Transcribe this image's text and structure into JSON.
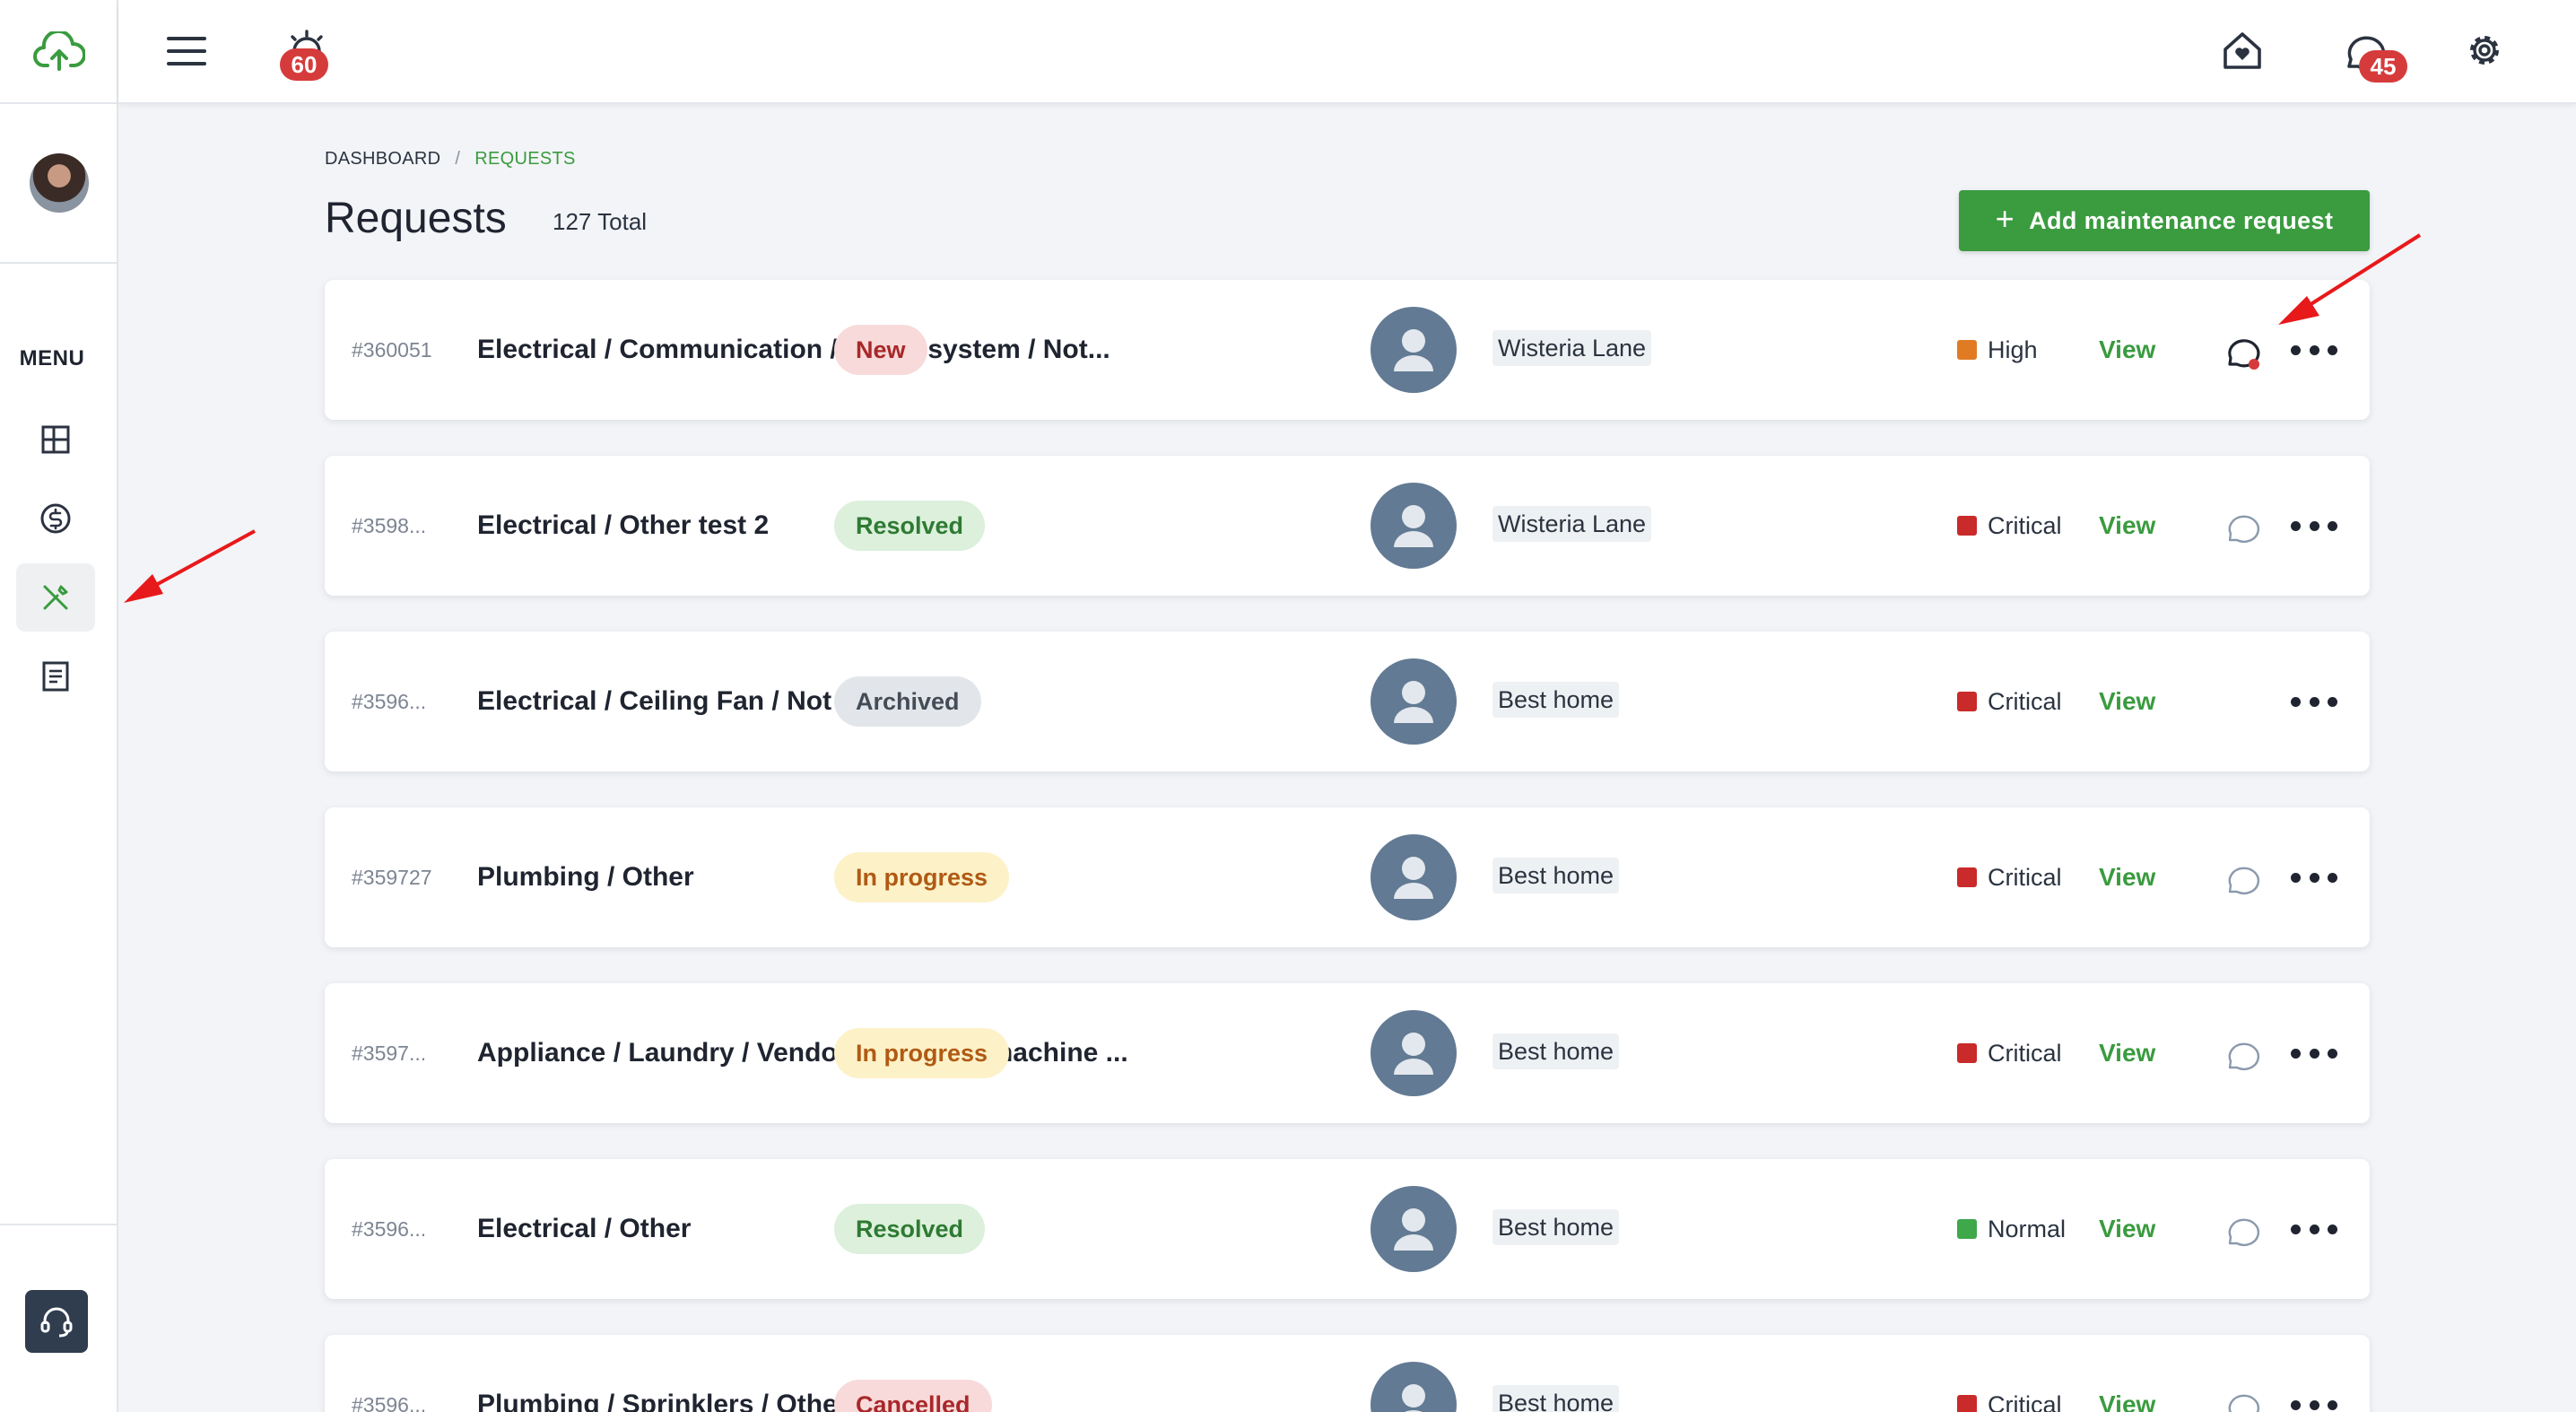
{
  "topbar": {
    "alarm_badge": "60",
    "chat_badge": "45"
  },
  "sidebar": {
    "menu_title": "MENU"
  },
  "breadcrumb": {
    "home": "DASHBOARD",
    "separator": "/",
    "current": "REQUESTS"
  },
  "page": {
    "title": "Requests",
    "total": "127 Total",
    "add_button": "Add maintenance request",
    "add_icon": "+"
  },
  "rows": [
    {
      "id": "#360051",
      "title": "Electrical / Communication / Alarm system / Not...",
      "status": "New",
      "property": "Wisteria Lane",
      "priority": "High",
      "view": "View"
    },
    {
      "id": "#3598...",
      "title": "Electrical / Other test 2",
      "status": "Resolved",
      "property": "Wisteria Lane",
      "priority": "Critical",
      "view": "View"
    },
    {
      "id": "#3596...",
      "title": "Electrical / Ceiling Fan / Not working",
      "status": "Archived",
      "property": "Best home",
      "priority": "Critical",
      "view": "View"
    },
    {
      "id": "#359727",
      "title": "Plumbing / Other",
      "status": "In progress",
      "property": "Best home",
      "priority": "Critical",
      "view": "View"
    },
    {
      "id": "#3597...",
      "title": "Appliance / Laundry / Vendor / Washing machine ...",
      "status": "In progress",
      "property": "Best home",
      "priority": "Critical",
      "view": "View"
    },
    {
      "id": "#3596...",
      "title": "Electrical / Other",
      "status": "Resolved",
      "property": "Best home",
      "priority": "Normal",
      "view": "View"
    },
    {
      "id": "#3596...",
      "title": "Plumbing / Sprinklers / Other",
      "status": "Cancelled",
      "property": "Best home",
      "priority": "Critical",
      "view": "View"
    }
  ],
  "colors": {
    "brand_green": "#3a9b3f",
    "priority_high": "#e07b24",
    "priority_critical": "#c92a2a",
    "priority_normal": "#3ea84a",
    "annotation_arrow": "#e8191b"
  }
}
